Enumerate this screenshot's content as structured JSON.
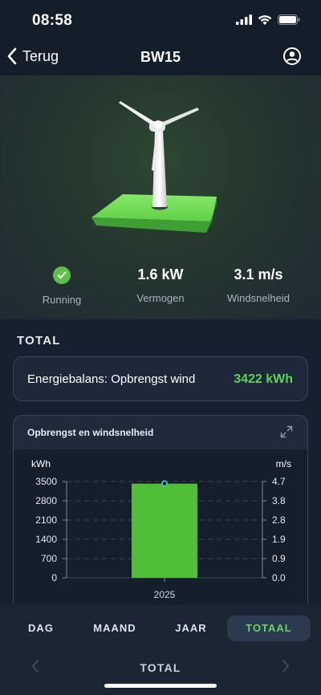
{
  "status": {
    "time": "08:58"
  },
  "nav": {
    "back_label": "Terug",
    "title": "BW15"
  },
  "stats": {
    "status_label": "Running",
    "power_value": "1.6 kW",
    "power_label": "Vermogen",
    "wind_value": "3.1 m/s",
    "wind_label": "Windsnelheid"
  },
  "section": {
    "label": "TOTAL"
  },
  "energy": {
    "label": "Energiebalans: Opbrengst wind",
    "value": "3422 kWh"
  },
  "chart": {
    "title": "Opbrengst en windsnelheid",
    "left_unit": "kWh",
    "right_unit": "m/s"
  },
  "chart_data": {
    "type": "bar",
    "title": "Opbrengst en windsnelheid",
    "categories": [
      "2025"
    ],
    "bar_values_kwh": [
      3422
    ],
    "line_values_ms": [
      4.6
    ],
    "ylabel_left": "kWh",
    "ylabel_right": "m/s",
    "ylim_left": [
      0,
      3500
    ],
    "ylim_right": [
      0,
      4.7
    ],
    "left_ticks": [
      "0",
      "700",
      "1400",
      "2100",
      "2800",
      "3500"
    ],
    "right_ticks": [
      "0.0",
      "0.9",
      "1.9",
      "2.8",
      "3.8",
      "4.7"
    ],
    "grid": true,
    "colors": {
      "bar": "#4fbf3a",
      "line_marker": "#3fd6c2"
    }
  },
  "tabs": [
    {
      "label": "DAG",
      "active": false
    },
    {
      "label": "MAAND",
      "active": false
    },
    {
      "label": "JAAR",
      "active": false
    },
    {
      "label": "TOTAAL",
      "active": true
    }
  ],
  "period": {
    "label": "TOTAL"
  },
  "colors": {
    "accent": "#5fd15a",
    "background": "#16202e"
  },
  "icons": [
    "signal-icon",
    "wifi-icon",
    "battery-icon",
    "chevron-left-icon",
    "profile-icon",
    "check-icon",
    "expand-icon",
    "chevron-right-icon"
  ]
}
